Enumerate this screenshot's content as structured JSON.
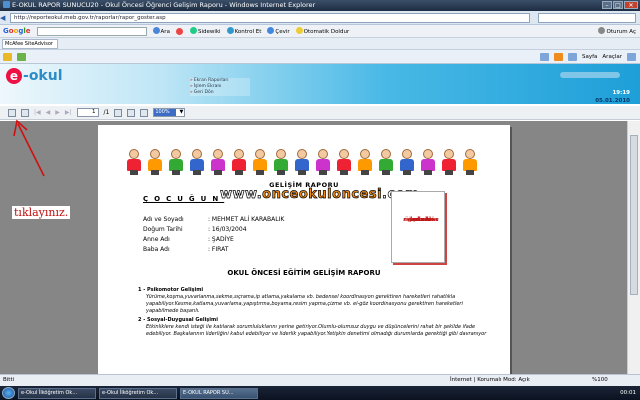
{
  "window": {
    "title": "E-OKUL RAPOR SUNUCU20 - Okul Öncesi Öğrenci Gelişim Raporu - Windows Internet Explorer"
  },
  "address": {
    "url": "http://reporteokul.meb.gov.tr/raporlar/rapor_goster.asp"
  },
  "google_bar": {
    "label_ara": "Ara",
    "label_sidewiki": "Sidewiki",
    "label_kontrol": "Kontrol Et",
    "label_cevir": "Çevir",
    "label_otomatik": "Otomatik Doldur",
    "label_oturum": "Oturum Aç"
  },
  "favorites": {
    "tab": "McAfee SiteAdvisor"
  },
  "command_bar": {
    "sayfa": "Sayfa",
    "araclar": "Araçlar"
  },
  "banner": {
    "logo_text": "okul",
    "links": [
      "Ekran Raporları",
      "İşlem Ekranı",
      "Geri Dön"
    ],
    "time": "19:19",
    "date": "05.01.2010"
  },
  "report_toolbar": {
    "page_current": "1",
    "page_total": "/1",
    "zoom": "100%"
  },
  "report": {
    "title": "GELİŞİM RAPORU",
    "child_heading": "ÇOCUĞUN",
    "watermark_prefix": "www.",
    "watermark_main": "onceokuloncesi",
    "watermark_suffix": ".com",
    "photo_note": [
      "e-okulda",
      "öğrencinin",
      "resmi varsa",
      "burada",
      "çıkar."
    ],
    "fields": [
      {
        "k": "Adı ve Soyadı",
        "v": ": MEHMET ALİ KARABALIK"
      },
      {
        "k": "Doğum Tarihi",
        "v": ": 16/03/2004"
      },
      {
        "k": "Anne Adı",
        "v": ": ŞADİYE"
      },
      {
        "k": "Baba Adı",
        "v": ": FIRAT"
      }
    ],
    "section_title": "OKUL ÖNCESİ EĞİTİM GELİŞİM RAPORU",
    "s1_title": "1 - Psikomotor Gelişimi",
    "s1_text": "Yürüme,koşma,yuvarlanma,sekme,sıçrama,ip atlama,yakalama vb. bedensel koordinasyon gerektiren hareketleri rahatlıkla yapabiliyor.Kesme,katlama,yuvarlama,yapıştırma,boyama,resim yapma,çizme vb. el-göz koordinasyonu gerektiren hareketleri yapabilmede başarılı.",
    "s2_title": "2 - Sosyal-Duygusal Gelişimi",
    "s2_text": "Etkinliklere kendi isteği ile katılarak sorumluluklarını yerine getiriyor.Olumlu-olumsuz duygu ve düşüncelerini rahat bir şekilde ifade edebiliyor. Başkalarının liderliğini kabul edebiliyor ve liderlik yapabiliyor.Yetişkin denetimi olmadığı durumlarda gerektiği gibi davranıyor"
  },
  "annotation": {
    "text": "tıklayınız."
  },
  "status": {
    "left": "Bitti",
    "zone": "İnternet | Korumalı Mod: Açık",
    "zoom": "%100"
  },
  "taskbar": {
    "items": [
      "e-Okul İlköğretim Ok...",
      "e-Okul İlköğretim Ok...",
      "E-OKUL RAPOR SU..."
    ],
    "clock": "00:01"
  },
  "colors": {
    "banner": "#1e9fd8",
    "annotation": "#c01010",
    "photo_note": "#c01818"
  }
}
